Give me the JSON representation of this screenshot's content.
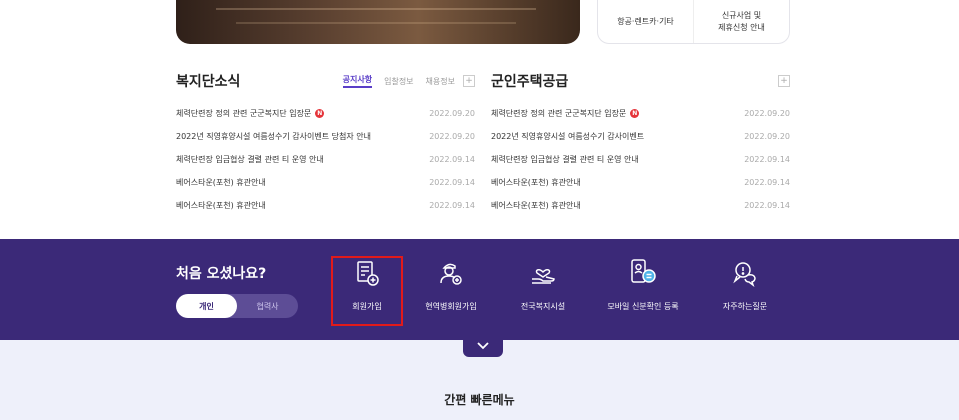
{
  "quick_card": {
    "left_label": "항공·렌트카·기타",
    "right_label_line1": "신규사업 및",
    "right_label_line2": "제휴신청 안내"
  },
  "welfare_news": {
    "title": "복지단소식",
    "tabs": [
      "공지사항",
      "입찰정보",
      "채용정보"
    ],
    "active_tab": "공지사항",
    "more_symbol": "+",
    "items": [
      {
        "title": "체력단련장 정의 관련 군군복지단 입장문",
        "date": "2022.09.20",
        "badge": "N"
      },
      {
        "title": "2022년 직영휴양시설 여름성수기 감사이벤트 당첨자 안내",
        "date": "2022.09.20",
        "badge": ""
      },
      {
        "title": "체력단련장 입금협상 결렬 관련 티 운영 안내",
        "date": "2022.09.14",
        "badge": ""
      },
      {
        "title": "베어스타운(포천) 휴관안내",
        "date": "2022.09.14",
        "badge": ""
      },
      {
        "title": "베어스타운(포천) 휴관안내",
        "date": "2022.09.14",
        "badge": ""
      }
    ]
  },
  "housing": {
    "title": "군인주택공급",
    "more_symbol": "+",
    "items": [
      {
        "title": "체력단련장 정의 관련 군군복지단 입장문",
        "date": "2022.09.20",
        "badge": "N"
      },
      {
        "title": "2022년 직영휴양시설 여름성수기 감사이벤트",
        "date": "2022.09.20",
        "badge": ""
      },
      {
        "title": "체력단련장 입금협상 결렬 관련 티 운영 안내",
        "date": "2022.09.14",
        "badge": ""
      },
      {
        "title": "베어스타운(포천) 휴관안내",
        "date": "2022.09.14",
        "badge": ""
      },
      {
        "title": "베어스타운(포천) 휴관안내",
        "date": "2022.09.14",
        "badge": ""
      }
    ]
  },
  "welcome": {
    "title": "처음 오셨나요?",
    "toggle": [
      "개인",
      "협력사"
    ],
    "active": "개인",
    "menu": [
      {
        "label": "회원가입",
        "icon": "signup-doc-icon"
      },
      {
        "label": "현역병회원가입",
        "icon": "soldier-signup-icon"
      },
      {
        "label": "전국복지시설",
        "icon": "facility-heart-icon"
      },
      {
        "label": "모바일 신분확인 등록",
        "icon": "mobile-id-icon"
      },
      {
        "label": "자주하는질문",
        "icon": "faq-icon"
      }
    ],
    "highlighted": "회원가입"
  },
  "quick_menu": {
    "title": "간편 빠른메뉴"
  },
  "colors": {
    "brand_purple": "#3b2978",
    "accent_purple": "#5a3ec8",
    "highlight_red": "#e11a1a",
    "badge_red": "#e5343a",
    "bottom_bg": "#eef0fa"
  }
}
